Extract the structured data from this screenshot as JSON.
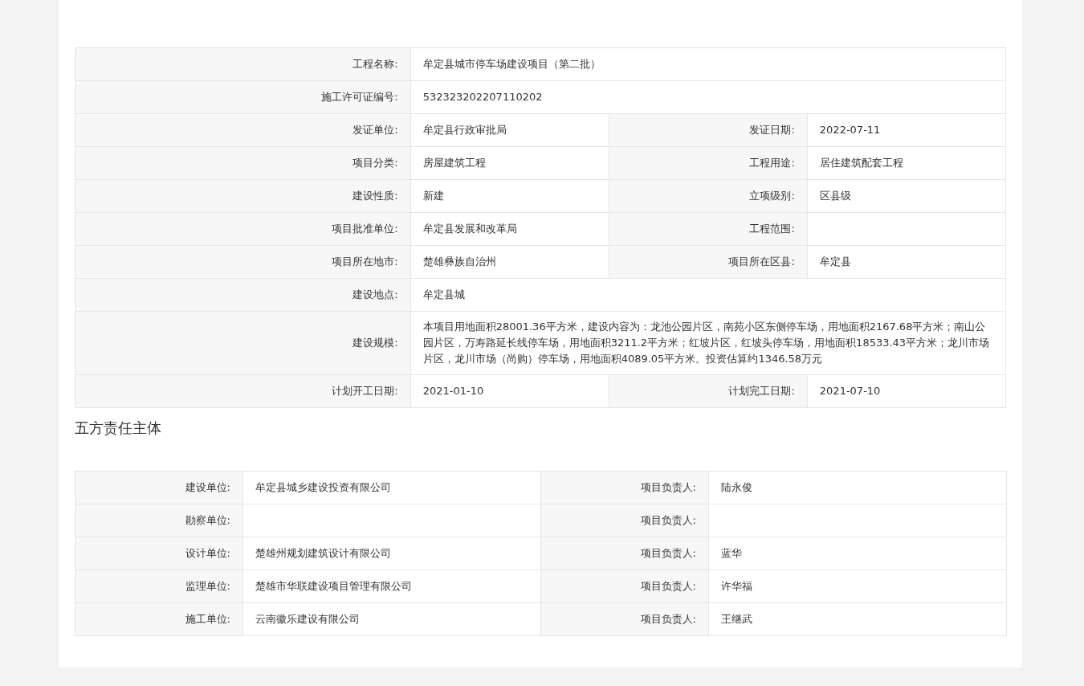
{
  "project_info": {
    "rows": [
      [
        {
          "label": "工程名称:",
          "value": "牟定县城市停车场建设项目（第二批）"
        }
      ],
      [
        {
          "label": "施工许可证编号:",
          "value": "532323202207110202"
        }
      ],
      [
        {
          "label": "发证单位:",
          "value": "牟定县行政审批局"
        },
        {
          "label": "发证日期:",
          "value": "2022-07-11"
        }
      ],
      [
        {
          "label": "项目分类:",
          "value": "房屋建筑工程"
        },
        {
          "label": "工程用途:",
          "value": "居住建筑配套工程"
        }
      ],
      [
        {
          "label": "建设性质:",
          "value": "新建"
        },
        {
          "label": "立项级别:",
          "value": "区县级"
        }
      ],
      [
        {
          "label": "项目批准单位:",
          "value": "牟定县发展和改革局"
        },
        {
          "label": "工程范围:"
        }
      ],
      [
        {
          "label": "项目所在地市:",
          "value": "楚雄彝族自治州"
        },
        {
          "label": "项目所在区县:",
          "value": "牟定县"
        }
      ],
      [
        {
          "label": "建设地点:",
          "value": "牟定县城"
        }
      ],
      [
        {
          "label": "建设规模:",
          "value": "本项目用地面积28001.36平方米，建设内容为：龙池公园片区，南苑小区东侧停车场，用地面积2167.68平方米；南山公园片区，万寿路延长线停车场，用地面积3211.2平方米；红坡片区，红坡头停车场，用地面积18533.43平方米；龙川市场片区，龙川市场（尚购）停车场，用地面积4089.05平方米。投资估算约1346.58万元"
        }
      ],
      [
        {
          "label": "计划开工日期:",
          "value": "2021-01-10"
        },
        {
          "label": "计划完工日期:",
          "value": "2021-07-10"
        }
      ]
    ]
  },
  "responsible_parties": {
    "title": "五方责任主体",
    "rows": [
      [
        {
          "label": "建设单位:",
          "value": "牟定县城乡建设投资有限公司"
        },
        {
          "label": "项目负责人:",
          "value": "陆永俊"
        }
      ],
      [
        {
          "label": "勘察单位:"
        },
        {
          "label": "项目负责人:"
        }
      ],
      [
        {
          "label": "设计单位:",
          "value": "楚雄州规划建筑设计有限公司"
        },
        {
          "label": "项目负责人:",
          "value": "蓝华"
        }
      ],
      [
        {
          "label": "监理单位:",
          "value": "楚雄市华联建设项目管理有限公司"
        },
        {
          "label": "项目负责人:",
          "value": "许华福"
        }
      ],
      [
        {
          "label": "施工单位:",
          "value": "云南徽乐建设有限公司"
        },
        {
          "label": "项目负责人:",
          "value": "王继武"
        }
      ]
    ]
  }
}
